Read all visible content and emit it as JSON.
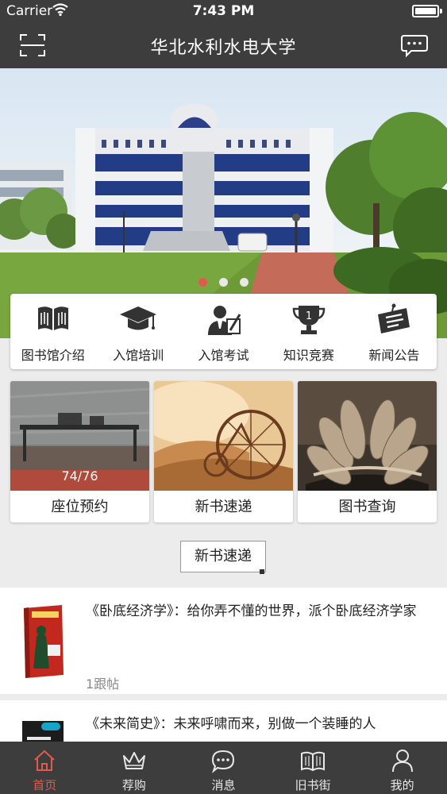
{
  "status": {
    "carrier": "Carrier",
    "time": "7:43 PM"
  },
  "nav": {
    "title": "华北水利水电大学",
    "left_icon": "scan-icon",
    "right_icon": "message-icon"
  },
  "banner": {
    "page_count": 3,
    "active_index": 0
  },
  "quick_menu": [
    {
      "label": "图书馆介绍",
      "icon": "book-icon"
    },
    {
      "label": "入馆培训",
      "icon": "graduation-cap-icon"
    },
    {
      "label": "入馆考试",
      "icon": "exam-icon"
    },
    {
      "label": "知识竞赛",
      "icon": "trophy-icon"
    },
    {
      "label": "新闻公告",
      "icon": "announcement-icon"
    }
  ],
  "cards": [
    {
      "label": "座位预约",
      "overlay": "74/76"
    },
    {
      "label": "新书速递"
    },
    {
      "label": "图书查询"
    }
  ],
  "section": {
    "button_label": "新书速递"
  },
  "news": [
    {
      "title": "《卧底经济学》：给你弄不懂的世界，派个卧底经济学家",
      "meta": "1跟帖"
    },
    {
      "title": "《未来简史》：未来呼啸而来，别做一个装睡的人",
      "meta": ""
    }
  ],
  "tabs": [
    {
      "label": "首页",
      "icon": "home-icon",
      "active": true
    },
    {
      "label": "荐购",
      "icon": "crown-icon",
      "active": false
    },
    {
      "label": "消息",
      "icon": "chat-icon",
      "active": false
    },
    {
      "label": "旧书街",
      "icon": "open-book-icon",
      "active": false
    },
    {
      "label": "我的",
      "icon": "user-icon",
      "active": false
    }
  ],
  "colors": {
    "bar": "#3d3d3d",
    "accent": "#e05b4d",
    "background": "#ececec"
  }
}
